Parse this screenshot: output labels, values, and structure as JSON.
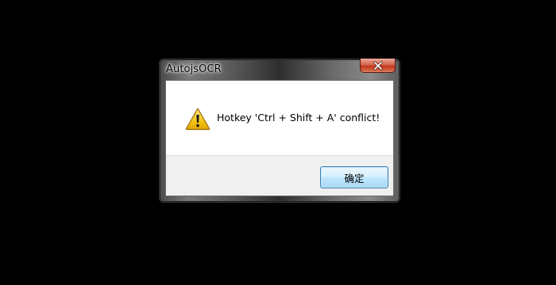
{
  "window": {
    "title": "AutojsOCR",
    "close_icon": "close-icon"
  },
  "message": {
    "icon": "warning-icon",
    "text": "Hotkey 'Ctrl + Shift + A' conflict!"
  },
  "buttons": {
    "ok_label": "确定"
  },
  "colors": {
    "desktop_background": "#000000",
    "close_button": "#c33a1f",
    "ok_button_border": "#3c7fb1",
    "warning_yellow": "#f5c518"
  }
}
